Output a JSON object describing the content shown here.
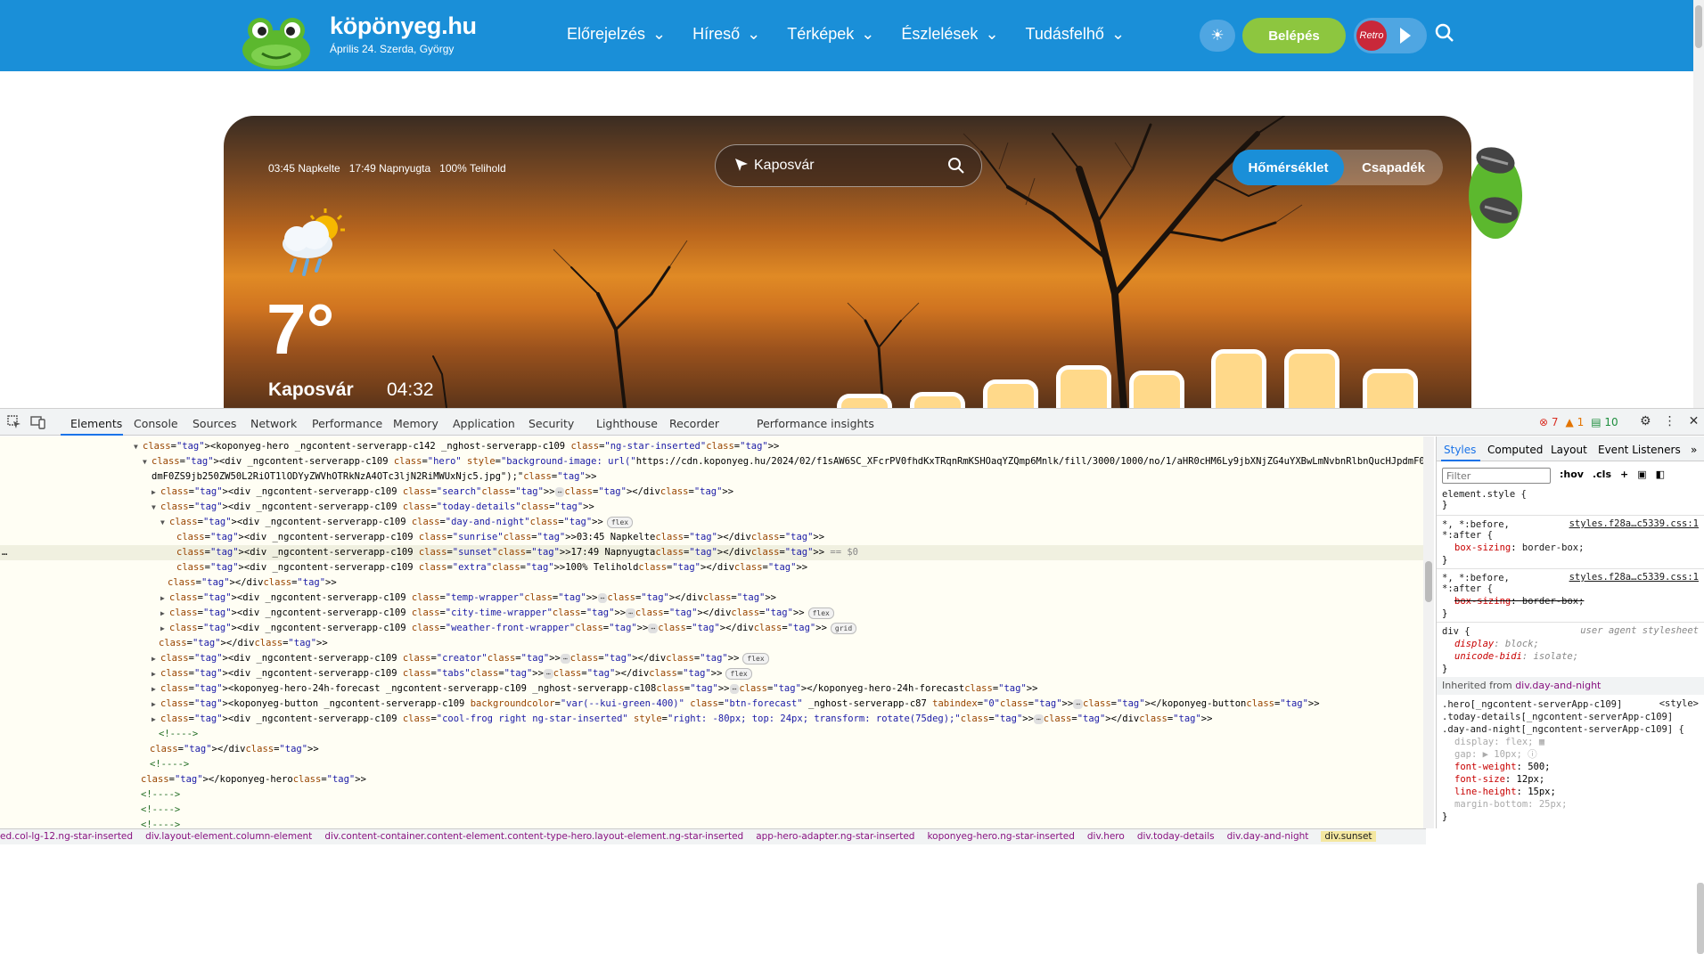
{
  "site": {
    "name": "köpönyeg.hu",
    "date_line": "Április 24. Szerda, György",
    "nav": [
      "Előrejelzés",
      "Híreső",
      "Térképek",
      "Észlelések",
      "Tudásfelhő"
    ],
    "login": "Belépés",
    "radio_label": "Retro"
  },
  "hero": {
    "sunrise": "03:45 Napkelte",
    "sunset": "17:49 Napnyugta",
    "extra": "100% Telihold",
    "temperature": "7°",
    "city": "Kaposvár",
    "time": "04:32",
    "search_value": "Kaposvár",
    "tabs": [
      "Hőmérséklet",
      "Csapadék"
    ],
    "icon": "rain-cloud-sun-icon"
  },
  "devtools": {
    "tabs": [
      "Elements",
      "Console",
      "Sources",
      "Network",
      "Performance",
      "Memory",
      "Application",
      "Security",
      "Lighthouse",
      "Recorder",
      "Performance insights"
    ],
    "errors": "7",
    "warnings": "1",
    "infos": "10",
    "dom_lines": [
      {
        "text": "<koponyeg-hero _ngcontent-serverapp-c142 _nghost-serverapp-c109 class=\"ng-star-inserted\">",
        "indent": 150,
        "tri": "▼"
      },
      {
        "text": "<div _ngcontent-serverapp-c109 class=\"hero\" style=\"background-image: url(\"https://cdn.koponyeg.hu/2024/02/f1sAW6SC_XFcrPV0fhdKxTRqnRmKSHOaqYZQmp6Mnlk/fill/3000/1000/no/1/aHR0cHM6Ly9jbXNjZG4uYXBwLmNvbnRlbnQucHJpdmF0ZS5jb250ZW50L2RiOT1lODYyZWVhOTRkNzA4OTc3ljN2RiMWUxNjc5.jpg\");\">",
        "indent": 160,
        "tri": "▼"
      },
      {
        "text": "dmF0ZS9jb250ZW50L2RiOT1lODYyZWVhOTRkNzA4OTc3ljN2RiMWUxNjc5.jpg\");\">",
        "indent": 170,
        "tri": ""
      },
      {
        "text": "<div _ngcontent-serverapp-c109 class=\"search\">⋯</div>",
        "indent": 170,
        "tri": "▶"
      },
      {
        "text": "<div _ngcontent-serverapp-c109 class=\"today-details\">",
        "indent": 170,
        "tri": "▼"
      },
      {
        "text": "<div _ngcontent-serverapp-c109 class=\"day-and-night\">",
        "indent": 180,
        "tri": "▼",
        "badge": "flex"
      },
      {
        "text": "<div _ngcontent-serverapp-c109 class=\"sunrise\">03:45 Napkelte</div>",
        "indent": 198,
        "tri": ""
      },
      {
        "text": "<div _ngcontent-serverapp-c109 class=\"sunset\">17:49 Napnyugta</div> == $0",
        "indent": 198,
        "tri": "",
        "selected": true
      },
      {
        "text": "<div _ngcontent-serverapp-c109 class=\"extra\">100% Telihold</div>",
        "indent": 198,
        "tri": ""
      },
      {
        "text": "</div>",
        "indent": 188,
        "tri": ""
      },
      {
        "text": "<div _ngcontent-serverapp-c109 class=\"temp-wrapper\">⋯</div>",
        "indent": 180,
        "tri": "▶"
      },
      {
        "text": "<div _ngcontent-serverapp-c109 class=\"city-time-wrapper\">⋯</div>",
        "indent": 180,
        "tri": "▶",
        "badge": "flex"
      },
      {
        "text": "<div _ngcontent-serverapp-c109 class=\"weather-front-wrapper\">⋯</div>",
        "indent": 180,
        "tri": "▶",
        "badge": "grid"
      },
      {
        "text": "</div>",
        "indent": 178,
        "tri": ""
      },
      {
        "text": "<div _ngcontent-serverapp-c109 class=\"creator\">⋯</div>",
        "indent": 170,
        "tri": "▶",
        "badge": "flex"
      },
      {
        "text": "<div _ngcontent-serverapp-c109 class=\"tabs\">⋯</div>",
        "indent": 170,
        "tri": "▶",
        "badge": "flex"
      },
      {
        "text": "<koponyeg-hero-24h-forecast _ngcontent-serverapp-c109 _nghost-serverapp-c108>⋯</koponyeg-hero-24h-forecast>",
        "indent": 170,
        "tri": "▶"
      },
      {
        "text": "<koponyeg-button _ngcontent-serverapp-c109 backgroundcolor=\"var(--kui-green-400)\" class=\"btn-forecast\" _nghost-serverapp-c87 tabindex=\"0\">⋯</koponyeg-button>",
        "indent": 170,
        "tri": "▶"
      },
      {
        "text": "<div _ngcontent-serverapp-c109 class=\"cool-frog right ng-star-inserted\" style=\"right: -80px; top: 24px; transform: rotate(75deg);\">⋯</div>",
        "indent": 170,
        "tri": "▶"
      },
      {
        "text": "<!---->",
        "indent": 178,
        "tri": "",
        "comment": true
      },
      {
        "text": "</div>",
        "indent": 168,
        "tri": ""
      },
      {
        "text": "<!---->",
        "indent": 168,
        "tri": "",
        "comment": true
      },
      {
        "text": "</koponyeg-hero>",
        "indent": 158,
        "tri": ""
      },
      {
        "text": "<!---->",
        "indent": 158,
        "tri": "",
        "comment": true
      },
      {
        "text": "<!---->",
        "indent": 158,
        "tri": "",
        "comment": true
      },
      {
        "text": "<!---->",
        "indent": 158,
        "tri": "",
        "comment": true
      }
    ],
    "styles_tabs": [
      "Styles",
      "Computed",
      "Layout",
      "Event Listeners"
    ],
    "filter_placeholder": "Filter",
    "hov": ":hov",
    "cls": ".cls",
    "inherited_from_label": "Inherited from",
    "inherited_from_node": "div.day-and-night",
    "breadcrumbs": [
      "ed.col-lg-12.ng-star-inserted",
      "div.layout-element.column-element",
      "div.content-container.content-element.content-type-hero.layout-element.ng-star-inserted",
      "app-hero-adapter.ng-star-inserted",
      "koponyeg-hero.ng-star-inserted",
      "div.hero",
      "div.today-details",
      "div.day-and-night",
      "div.sunset"
    ]
  }
}
